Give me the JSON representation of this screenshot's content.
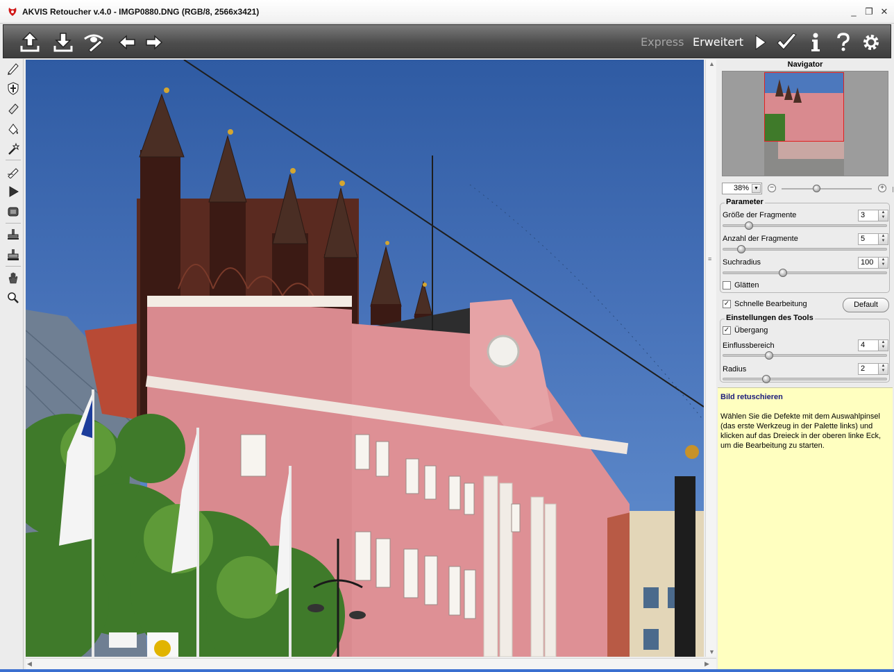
{
  "window": {
    "title": "AKVIS Retoucher v.4.0 - IMGP0880.DNG (RGB/8, 2566x3421)",
    "controls": [
      "minimize",
      "restore",
      "close"
    ]
  },
  "toolbar": {
    "buttons": [
      "open-icon",
      "save-icon",
      "preferences-icon",
      "undo-icon",
      "redo-icon",
      "run-icon",
      "apply-icon",
      "info-icon",
      "help-icon",
      "settings-icon"
    ],
    "mode_express": "Express",
    "mode_advanced": "Erweitert"
  },
  "tools": [
    "selection-brush-icon",
    "protection-icon",
    "eraser-icon",
    "fill-icon",
    "magic-wand-icon",
    "pencil-icon",
    "run-small-icon",
    "patch-icon",
    "stamp-icon",
    "clone-stamp-icon",
    "hand-icon",
    "zoom-icon"
  ],
  "navigator": {
    "title": "Navigator",
    "zoom": "38%",
    "zoom_level": 0.38
  },
  "parameters": {
    "title": "Parameter",
    "fragment_size_label": "Größe der Fragmente",
    "fragment_size": "3",
    "fragment_size_level": 0.14,
    "fragment_count_label": "Anzahl der Fragmente",
    "fragment_count": "5",
    "fragment_count_level": 0.09,
    "search_radius_label": "Suchradius",
    "search_radius": "100",
    "search_radius_level": 0.36,
    "smooth_label": "Glätten",
    "smooth_checked": false
  },
  "quick_processing": {
    "label": "Schnelle Bearbeitung",
    "checked": true,
    "default_button": "Default"
  },
  "tool_settings": {
    "title": "Einstellungen des Tools",
    "transition_label": "Übergang",
    "transition_checked": true,
    "influence_label": "Einflussbereich",
    "influence": "4",
    "influence_level": 0.27,
    "radius_label": "Radius",
    "radius": "2",
    "radius_level": 0.25
  },
  "help": {
    "title": "Bild retuschieren",
    "text": "Wählen Sie die Defekte mit dem Auswahlpinsel (das erste Werkzeug in der Palette links) und klicken auf das Dreieck in der oberen linke Eck, um die Bearbeitung zu starten."
  },
  "colors": {
    "toolbar_bg": "#4d4d4d",
    "help_bg": "#ffffc0",
    "nav_frame": "#e02020"
  }
}
